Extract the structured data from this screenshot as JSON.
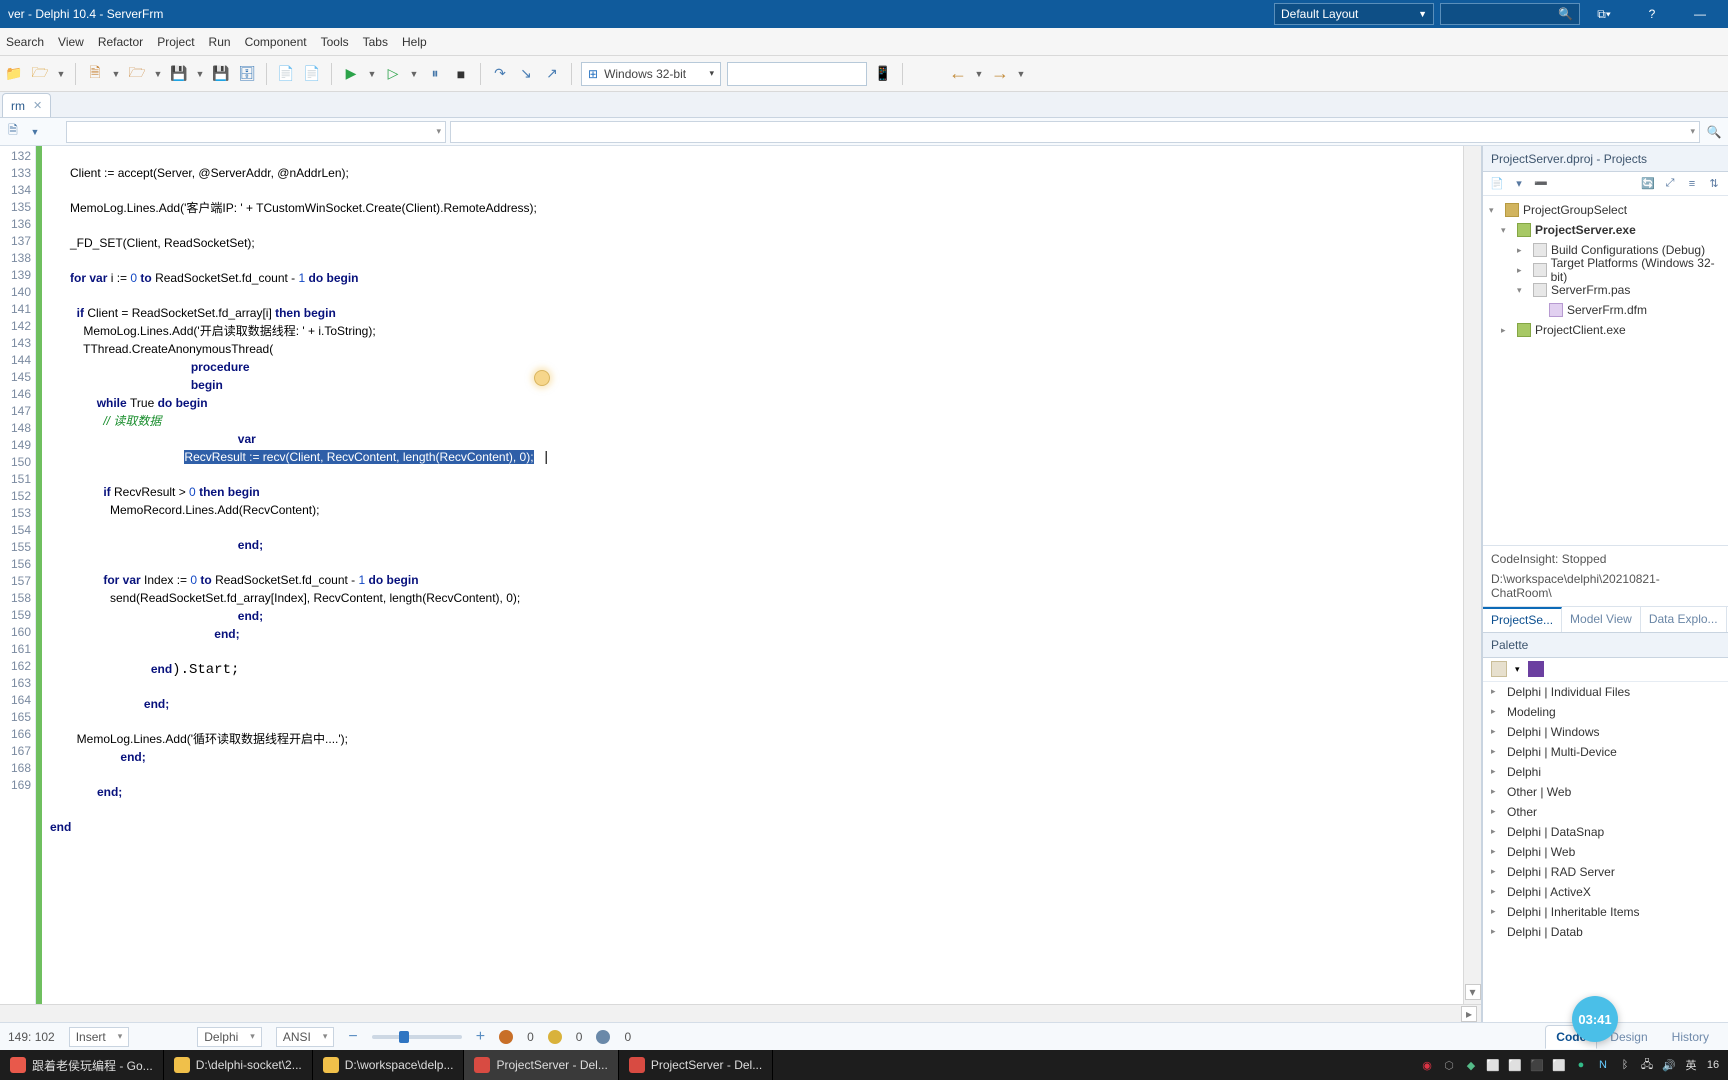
{
  "titlebar": {
    "title": "ver - Delphi 10.4 - ServerFrm",
    "layout": "Default Layout"
  },
  "menu": [
    "Search",
    "View",
    "Refactor",
    "Project",
    "Run",
    "Component",
    "Tools",
    "Tabs",
    "Help"
  ],
  "toolbar": {
    "platform": "Windows 32-bit"
  },
  "filetab": {
    "name": "rm"
  },
  "gutter_start": 132,
  "code": {
    "l132": "      Client := accept(Server, @ServerAddr, @nAddrLen);",
    "l134": "      MemoLog.Lines.Add('客户端IP: ' + TCustomWinSocket.Create(Client).RemoteAddress);",
    "l136": "      _FD_SET(Client, ReadSocketSet);",
    "l138_pre": "      ",
    "l138_for": "for var ",
    "l138_mid": "i := ",
    "l138_zero": "0",
    "l138_to": " to ",
    "l138_rest": "ReadSocketSet.fd_count - ",
    "l138_one": "1",
    "l138_do": " do begin",
    "l140_pre": "        ",
    "l140_if": "if ",
    "l140_mid": "Client = ReadSocketSet.fd_array[i] ",
    "l140_then": "then begin",
    "l141": "          MemoLog.Lines.Add('开启读取数据线程: ' + i.ToString);",
    "l142": "          TThread.CreateAnonymousThread(",
    "l143": "            procedure",
    "l144": "            begin",
    "l145_pre": "              ",
    "l145_while": "while ",
    "l145_true": "True ",
    "l145_do": "do begin",
    "l146_cmt": "                // 读取数据",
    "l147": "                var",
    "l148_sel": "RecvResult := recv(Client, RecvContent, length(RecvContent), 0);",
    "l150_pre": "                ",
    "l150_if": "if ",
    "l150_mid": "RecvResult > ",
    "l150_zero": "0",
    "l150_then": " then begin",
    "l151": "                  MemoRecord.Lines.Add(RecvContent);",
    "l153": "                end;",
    "l155_pre": "                ",
    "l155_for": "for var ",
    "l155_mid": "Index := ",
    "l155_zero": "0",
    "l155_to": " to ",
    "l155_rest": "ReadSocketSet.fd_count - ",
    "l155_one": "1",
    "l155_do": " do begin",
    "l156": "                  send(ReadSocketSet.fd_array[Index], RecvContent, length(RecvContent), 0);",
    "l157": "                end;",
    "l158": "              end;",
    "l160": "            end).Start;",
    "l162": "        end;",
    "l164": "        MemoLog.Lines.Add('循环读取数据线程开启中....');",
    "l165": "      end;",
    "l167": "    end;",
    "l169": "end"
  },
  "status": {
    "pos": "149: 102",
    "mode": "Insert",
    "lang": "Delphi",
    "enc": "ANSI",
    "err0a": "0",
    "err0b": "0",
    "err0c": "0",
    "tabs": [
      "Code",
      "Design",
      "History"
    ]
  },
  "projects": {
    "title": "ProjectServer.dproj - Projects",
    "group": "ProjectGroupSelect",
    "exe": "ProjectServer.exe",
    "build": "Build Configurations (Debug)",
    "target": "Target Platforms (Windows 32-bit)",
    "pas": "ServerFrm.pas",
    "dfm": "ServerFrm.dfm",
    "client": "ProjectClient.exe",
    "insight": "CodeInsight: Stopped",
    "path": "D:\\workspace\\delphi\\20210821-ChatRoom\\",
    "tabs": [
      "ProjectSe...",
      "Model View",
      "Data Explo..."
    ]
  },
  "palette": {
    "title": "Palette",
    "items": [
      "Delphi | Individual Files",
      "Modeling",
      "Delphi | Windows",
      "Delphi | Multi-Device",
      "Delphi",
      "Other | Web",
      "Other",
      "Delphi | DataSnap",
      "Delphi | Web",
      "Delphi | RAD Server",
      "Delphi | ActiveX",
      "Delphi | Inheritable Items",
      "Delphi | Datab"
    ]
  },
  "taskbar": {
    "items": [
      {
        "label": "跟着老侯玩编程 - Go...",
        "color": "#e8594b"
      },
      {
        "label": "D:\\delphi-socket\\2...",
        "color": "#f0c04a"
      },
      {
        "label": "D:\\workspace\\delp...",
        "color": "#f0c04a"
      },
      {
        "label": "ProjectServer - Del...",
        "color": "#d84b42"
      },
      {
        "label": "ProjectServer - Del...",
        "color": "#d84b42"
      }
    ],
    "lang": "英",
    "time_partial": "16",
    "clock_badge": "03:41"
  }
}
